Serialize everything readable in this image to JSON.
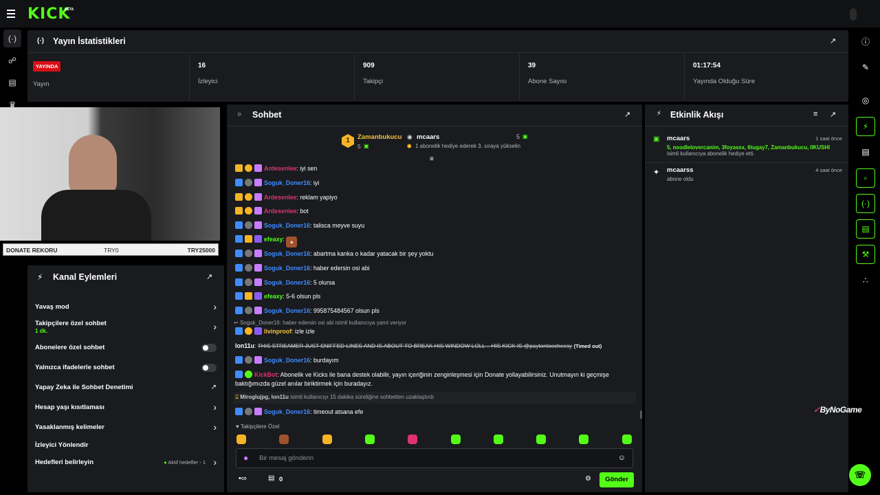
{
  "app": {
    "logo": "KICK",
    "beta": "BETA"
  },
  "stats_panel": {
    "title": "Yayın İstatistikleri",
    "stats": [
      {
        "value": "YAYINDA",
        "label": "Yayın"
      },
      {
        "value": "16",
        "label": "İzleyici"
      },
      {
        "value": "909",
        "label": "Takipçi"
      },
      {
        "value": "39",
        "label": "Abone Sayısı"
      },
      {
        "value": "01:17:54",
        "label": "Yayında Olduğu Süre"
      }
    ]
  },
  "donate": {
    "label": "DONATE REKORU",
    "min": "TRY0",
    "max": "TRY25000",
    "progress": 0
  },
  "actions_panel": {
    "title": "Kanal Eylemleri",
    "items": [
      {
        "label": "Yavaş mod",
        "control": "chevron"
      },
      {
        "label": "Takipçilere özel sohbet",
        "sub": "1 dk.",
        "control": "chevron"
      },
      {
        "label": "Abonelere özel sohbet",
        "control": "toggle"
      },
      {
        "label": "Yalnızca ifadelerle sohbet",
        "control": "toggle"
      },
      {
        "label": "Yapay Zeka ile Sohbet Denetimi",
        "control": "external"
      },
      {
        "label": "Hesap yaşı kısıtlaması",
        "control": "chevron"
      },
      {
        "label": "Yasaklanmış kelimeler",
        "control": "chevron"
      },
      {
        "label": "İzleyici Yönlendir",
        "control": "none"
      },
      {
        "label": "Hedefleri belirleyin",
        "control": "chevron",
        "status": "Aktif hedefler - 1"
      }
    ]
  },
  "chat": {
    "title": "Sohbet",
    "top_gifter": {
      "rank": "1",
      "name": "Zamanbukucu",
      "count": "5"
    },
    "gift_event": {
      "name": "mcaars",
      "count": "5",
      "text": "1 abonelik hediye ederek 3. sıraya yükselin"
    },
    "messages": [
      {
        "user": "Ardesenlee",
        "text": "iyi sen",
        "color": "#e0326e"
      },
      {
        "user": "Soguk_Doner16",
        "text": "iyi",
        "color": "#3f8cff"
      },
      {
        "user": "Ardesenlee",
        "text": "reklam yapiyo",
        "color": "#e0326e"
      },
      {
        "user": "Ardesenlee",
        "text": "bot",
        "color": "#e0326e"
      },
      {
        "user": "Soguk_Doner16",
        "text": "talisca meyve suyu",
        "color": "#3f8cff"
      },
      {
        "user": "efeaxy",
        "text": "",
        "color": "#53fc18"
      },
      {
        "user": "Soguk_Doner16",
        "text": "abartma kanka o kadar yatacak bir şey yoktu",
        "color": "#3f8cff"
      },
      {
        "user": "Soguk_Doner16",
        "text": "haber edersin osi abi",
        "color": "#3f8cff"
      },
      {
        "user": "Soguk_Doner16",
        "text": "5 olursa",
        "color": "#3f8cff"
      },
      {
        "user": "efeaxy",
        "text": "5-6 olsun pls",
        "color": "#53fc18"
      },
      {
        "user": "Soguk_Doner16",
        "text": "995875484567 olsun pls",
        "color": "#3f8cff"
      }
    ],
    "reply_note": "Soguk_Doner16: haber edersin osi abi isimli kullanıcıya yanıt veriyor",
    "reply_msg": {
      "user": "livinproof",
      "text": "izle izle",
      "color": "#f5c242"
    },
    "timed_out": {
      "user": "lon11u",
      "text": "THIS STREAMER JUST SNIFFED LINES AND IS ABOUT TO BREAK HIS WINDOW LOLL .. HIS KICK IS @paytontoocheesy",
      "tag": "(Timed out)"
    },
    "msg_burday": {
      "user": "Soguk_Doner16",
      "text": "burdayım",
      "color": "#3f8cff"
    },
    "bot_msg": {
      "user": "KickBot",
      "text": "Abonelik ve Kicks ile bana destek olabilir, yayın içeriğinin zenginleşmesi için Donate yollayabilirsiniz. Unutmayın ki geçmişe baktığımızda güzel anılar biriktirmek için buradayız.",
      "color": "#e0326e"
    },
    "ban_note": {
      "users": "Miroglujpg, lon11u",
      "text": "isimli kullanıcıyı 15 dakika süreliğine sohbetten uzaklaştırdı"
    },
    "last_msg": {
      "user": "Soguk_Doner16",
      "text": "timeout atsana efe",
      "color": "#3f8cff"
    },
    "emotes_label": "Takipçilere Özel",
    "input_placeholder": "Bir mesaj gönderin",
    "kicks_count": "0",
    "send_label": "Gönder"
  },
  "events_panel": {
    "title": "Etkinlik Akışı",
    "events": [
      {
        "user": "mcaars",
        "time": "1 saat önce",
        "names": "5, noodlelovercanim, 3foyassx, 6tugay7, Zamanbukucu, IIKUSHI",
        "desc": "isimli kullanıcıya abonelik hediye etti."
      },
      {
        "user": "mcaarss",
        "time": "4 saat önce",
        "desc": "abone oldu"
      }
    ]
  },
  "watermark": "ByNoGame",
  "colors": {
    "accent": "#53fc18",
    "live": "#d70e17",
    "panel": "#191b1f"
  }
}
